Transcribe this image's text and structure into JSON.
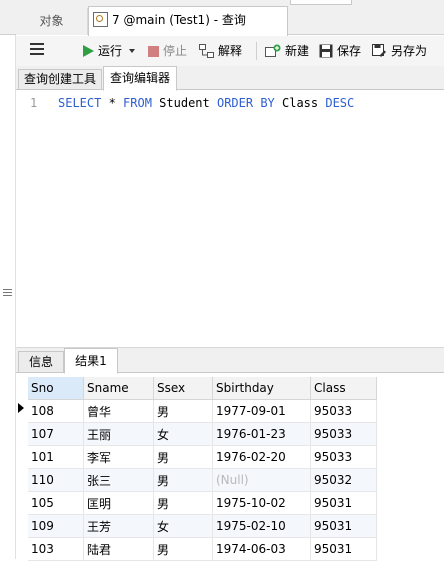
{
  "tabs": {
    "objects_label": "对象",
    "query_label": "7 @main (Test1) - 查询"
  },
  "toolbar": {
    "run_label": "运行",
    "stop_label": "停止",
    "explain_label": "解释",
    "new_label": "新建",
    "save_label": "保存",
    "save_as_label": "另存为"
  },
  "editor_tabs": {
    "builder_label": "查询创建工具",
    "editor_label": "查询编辑器"
  },
  "editor": {
    "line_number": "1",
    "tokens": {
      "select": "SELECT",
      "star": " * ",
      "from": "FROM",
      "table": " Student ",
      "order_by": "ORDER BY",
      "column": " Class ",
      "desc": "DESC"
    }
  },
  "result_tabs": {
    "info_label": "信息",
    "result_label": "结果1"
  },
  "grid": {
    "columns": [
      "Sno",
      "Sname",
      "Ssex",
      "Sbirthday",
      "Class"
    ],
    "rows": [
      [
        "108",
        "曾华",
        "男",
        "1977-09-01",
        "95033"
      ],
      [
        "107",
        "王丽",
        "女",
        "1976-01-23",
        "95033"
      ],
      [
        "101",
        "李军",
        "男",
        "1976-02-20",
        "95033"
      ],
      [
        "110",
        "张三",
        "男",
        "(Null)",
        "95032"
      ],
      [
        "105",
        "匡明",
        "男",
        "1975-10-02",
        "95031"
      ],
      [
        "109",
        "王芳",
        "女",
        "1975-02-10",
        "95031"
      ],
      [
        "103",
        "陆君",
        "男",
        "1974-06-03",
        "95031"
      ]
    ]
  },
  "colors": {
    "keyword": "#2e5fd0",
    "run_green": "#2ea043",
    "stop_red": "#d08080",
    "null_gray": "#b8b8b8",
    "selected_header": "#dbeaf9"
  }
}
